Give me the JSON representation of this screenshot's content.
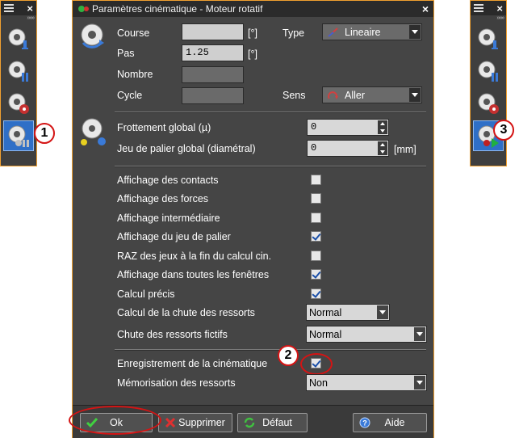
{
  "left_toolbar": {
    "callout": "1"
  },
  "right_toolbar": {
    "callout": "3"
  },
  "dialog": {
    "title": "Paramètres cinématique - Moteur rotatif",
    "course_label": "Course",
    "course_unit": "[°]",
    "pas_label": "Pas",
    "pas_value": "1.25",
    "pas_unit": "[°]",
    "nombre_label": "Nombre",
    "cycle_label": "Cycle",
    "type_label": "Type",
    "type_value": "Lineaire",
    "sens_label": "Sens",
    "sens_value": "Aller",
    "frottement_label": "Frottement global (µ)",
    "frottement_value": "0",
    "jeu_label": "Jeu de palier global (diamétral)",
    "jeu_value": "0",
    "jeu_unit": "[mm]",
    "options": [
      {
        "label": "Affichage des contacts",
        "checked": false
      },
      {
        "label": "Affichage des forces",
        "checked": false
      },
      {
        "label": "Affichage intermédiaire",
        "checked": false
      },
      {
        "label": "Affichage du jeu de palier",
        "checked": true
      },
      {
        "label": "RAZ des jeux à la fin du calcul cin.",
        "checked": false
      },
      {
        "label": "Affichage dans toutes les fenêtres",
        "checked": true
      },
      {
        "label": "Calcul précis",
        "checked": true
      }
    ],
    "chute_label": "Calcul de la chute des ressorts",
    "chute_value": "Normal",
    "fictifs_label": "Chute des ressorts fictifs",
    "fictifs_value": "Normal",
    "enreg_label": "Enregistrement de la cinématique",
    "enreg_checked": true,
    "enreg_callout": "2",
    "memo_label": "Mémorisation des ressorts",
    "memo_value": "Non",
    "buttons": {
      "ok": "Ok",
      "supprimer": "Supprimer",
      "defaut": "Défaut",
      "aide": "Aide"
    }
  },
  "colors": {
    "dialog_bg": "#454545",
    "border_accent": "#f0a030",
    "callout_red": "#d41414",
    "selected_blue": "#2f6fc7"
  }
}
